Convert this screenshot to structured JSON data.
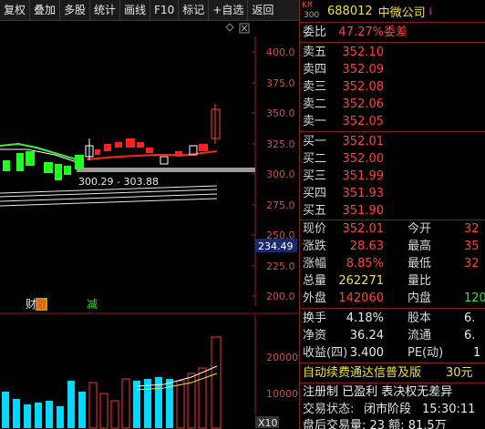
{
  "toolbar": {
    "buttons": [
      "复权",
      "叠加",
      "多股",
      "统计",
      "画线",
      "F10",
      "标记",
      "+自选",
      "返回"
    ]
  },
  "chart": {
    "price_axis_labels": [
      "400.0",
      "375.0",
      "350.0",
      "325.0",
      "300.0",
      "275.0",
      "250.0",
      "225.0",
      "200.0"
    ],
    "current_price_tag": "234.49",
    "range_label": "300.29 - 303.88",
    "event_cai": "财",
    "event_ji": "激",
    "event_jian": "减",
    "volume_axis_labels": [
      "20000",
      "10000"
    ],
    "volume_unit": "X10",
    "colors": {
      "up": "#ff2020",
      "down": "#20ff20",
      "volume": "#00d8ff",
      "axis": "#b01818"
    }
  },
  "quote": {
    "market_top": "KR",
    "market_bottom": "300",
    "code": "688012",
    "name": "中微公司",
    "info_icon": "i",
    "weibi_label": "委比",
    "weibi_value": "47.27%",
    "weicha_label": "委差",
    "sell": [
      {
        "label": "卖五",
        "price": "352.10"
      },
      {
        "label": "卖四",
        "price": "352.09"
      },
      {
        "label": "卖三",
        "price": "352.08"
      },
      {
        "label": "卖二",
        "price": "352.06"
      },
      {
        "label": "卖一",
        "price": "352.05"
      }
    ],
    "buy": [
      {
        "label": "买一",
        "price": "352.01"
      },
      {
        "label": "买二",
        "price": "352.00"
      },
      {
        "label": "买三",
        "price": "351.99"
      },
      {
        "label": "买四",
        "price": "351.93"
      },
      {
        "label": "买五",
        "price": "351.90"
      }
    ],
    "stats": [
      {
        "l1": "现价",
        "v1": "352.01",
        "l2": "今开",
        "v2": "32"
      },
      {
        "l1": "涨跌",
        "v1": "28.63",
        "l2": "最高",
        "v2": "35"
      },
      {
        "l1": "涨幅",
        "v1": "8.85%",
        "l2": "最低",
        "v2": "32"
      },
      {
        "l1": "总量",
        "v1": "262271",
        "l2": "量比",
        "v2": ""
      },
      {
        "l1": "外盘",
        "v1": "142060",
        "l2": "内盘",
        "v2": "120"
      }
    ],
    "fin": [
      {
        "l1": "换手",
        "v1": "4.18%",
        "l2": "股本",
        "v2": "6."
      },
      {
        "l1": "净资",
        "v1": "36.24",
        "l2": "流通",
        "v2": "6."
      },
      {
        "l1": "收益(四)",
        "v1": "3.400",
        "l2": "PE(动)",
        "v2": "1"
      }
    ],
    "promo_text": "自动续费通达信普及版",
    "promo_price": "30元",
    "reg_text": "注册制 已盈利 表决权无差异",
    "status_label": "交易状态:",
    "status_value": "闭市阶段",
    "status_time": "15:30:11",
    "after_hours": "盘后交易量: 23  额: 81.5万"
  }
}
